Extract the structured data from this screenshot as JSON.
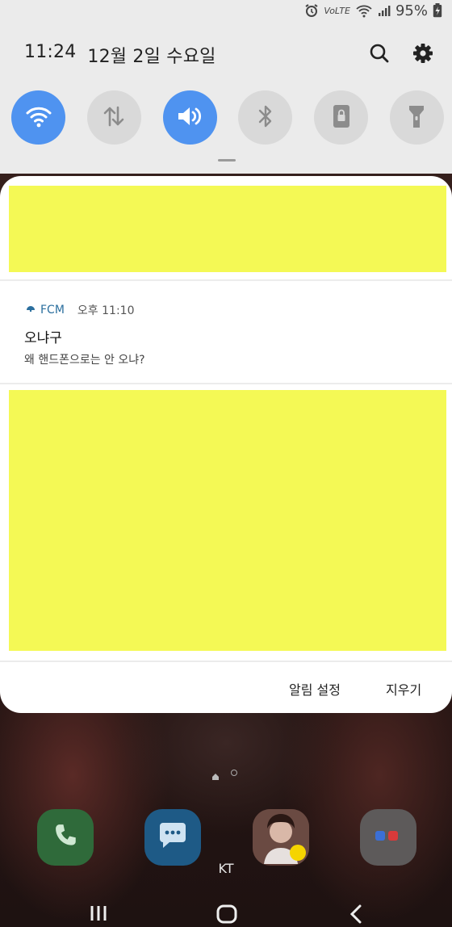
{
  "status_bar": {
    "network": "VoLTE",
    "battery": "95%"
  },
  "shade": {
    "time": "11:24",
    "date": "12월 2일 수요일"
  },
  "quick_settings": [
    {
      "name": "wifi",
      "state": "on"
    },
    {
      "name": "mobile-data",
      "state": "off"
    },
    {
      "name": "sound",
      "state": "on"
    },
    {
      "name": "bluetooth",
      "state": "off"
    },
    {
      "name": "portrait-lock",
      "state": "off"
    },
    {
      "name": "flashlight",
      "state": "off"
    }
  ],
  "notification": {
    "app_name": "FCM",
    "time": "오후 11:10",
    "title": "오냐구",
    "body": "왜 핸드폰으로는 안 오냐?"
  },
  "panel_actions": {
    "settings": "알림 설정",
    "clear": "지우기"
  },
  "home": {
    "carrier": "KT"
  },
  "colors": {
    "accent": "#4f93f0",
    "redaction": "#f4f955"
  }
}
